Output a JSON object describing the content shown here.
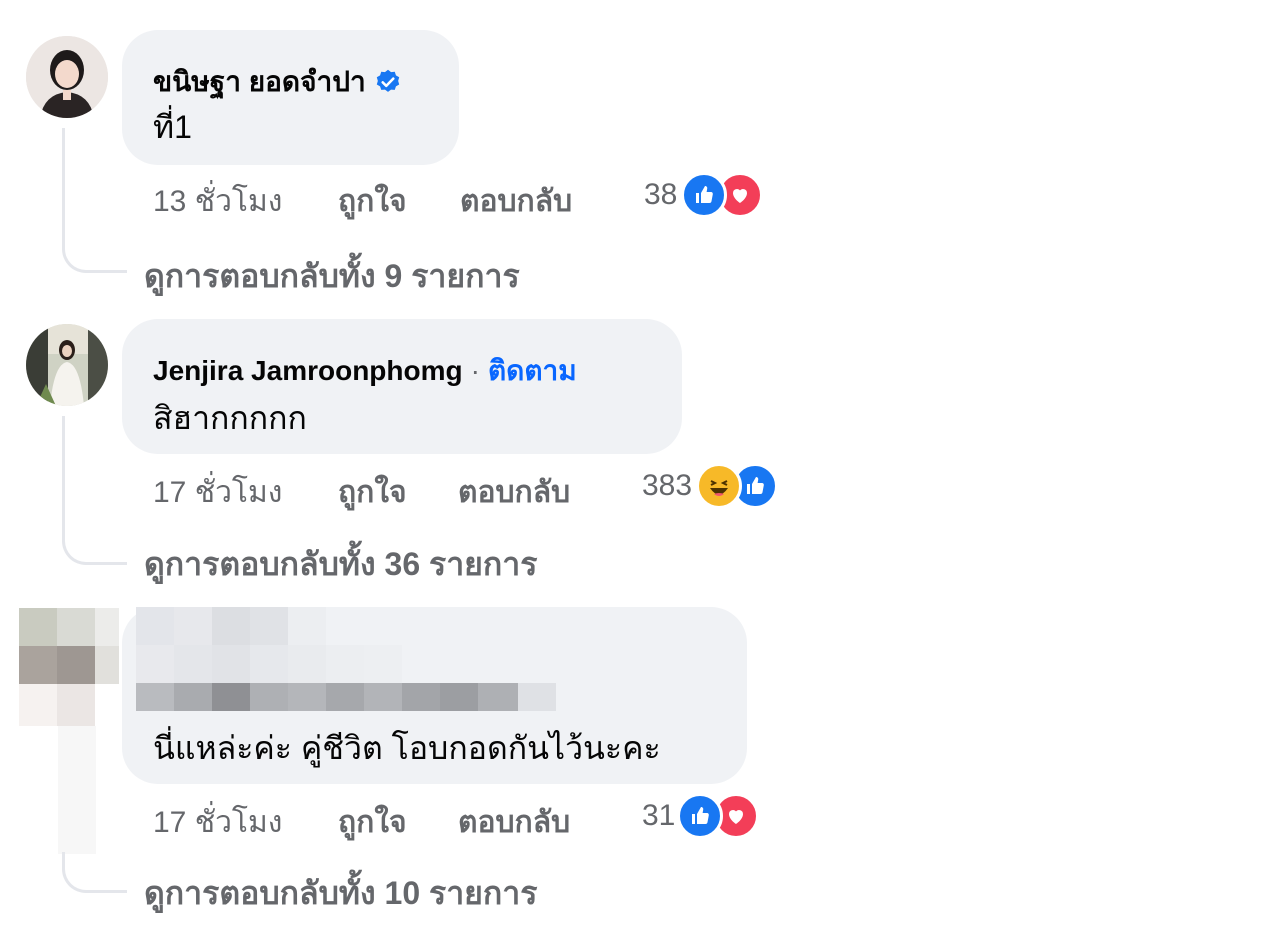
{
  "comments": [
    {
      "author": "ขนิษฐา ยอดจำปา",
      "verified": true,
      "text": "ที่1",
      "time": "13 ชั่วโมง",
      "like_label": "ถูกใจ",
      "reply_label": "ตอบกลับ",
      "reaction_count": "38",
      "reactions": [
        "like-icon",
        "love-icon"
      ],
      "view_replies": "ดูการตอบกลับทั้ง 9 รายการ"
    },
    {
      "author": "Jenjira Jamroonphomg",
      "separator": "·",
      "follow_label": "ติดตาม",
      "text": "สิฮากกกกก",
      "time": "17 ชั่วโมง",
      "like_label": "ถูกใจ",
      "reply_label": "ตอบกลับ",
      "reaction_count": "383",
      "reactions": [
        "haha-icon",
        "like-icon"
      ],
      "view_replies": "ดูการตอบกลับทั้ง 36 รายการ"
    },
    {
      "author": "",
      "text": "นี่แหล่ะค่ะ คู่ชีวิต โอบกอดกันไว้นะคะ",
      "time": "17 ชั่วโมง",
      "like_label": "ถูกใจ",
      "reply_label": "ตอบกลับ",
      "reaction_count": "31",
      "reactions": [
        "like-icon",
        "love-icon"
      ],
      "view_replies": "ดูการตอบกลับทั้ง 10 รายการ"
    }
  ],
  "colors": {
    "bubble": "#f0f2f5",
    "secondary_text": "#65676b",
    "link_blue": "#0866ff",
    "like_blue": "#1877f2",
    "love_red": "#f33e58",
    "haha_yellow": "#f7b928"
  }
}
